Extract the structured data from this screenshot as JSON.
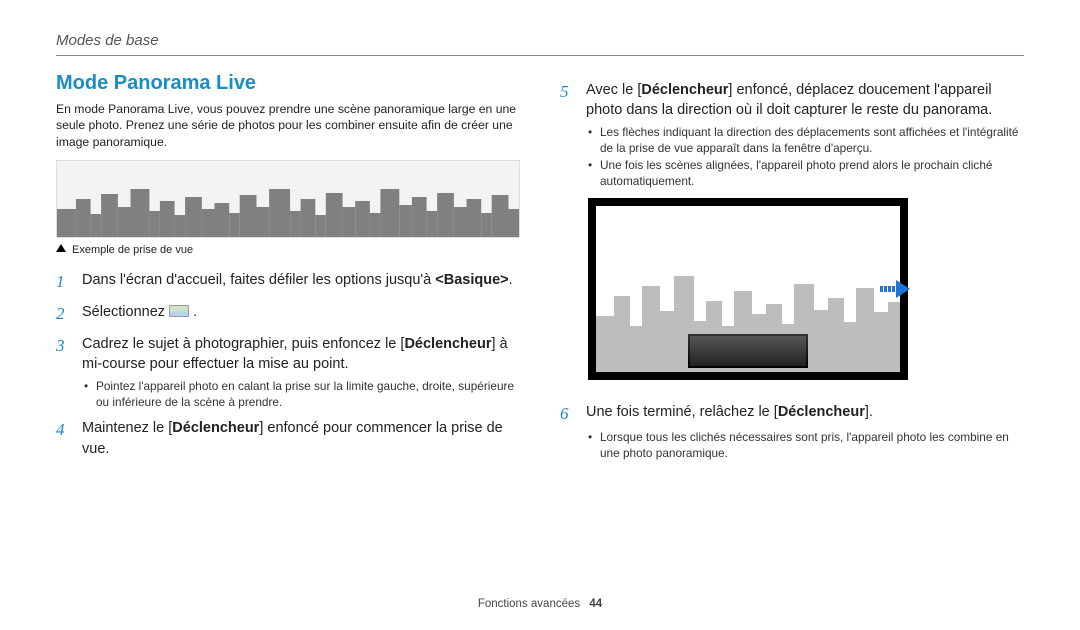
{
  "header": "Modes de base",
  "title": "Mode Panorama Live",
  "intro": "En mode Panorama Live, vous pouvez prendre une scène panoramique large en une seule photo. Prenez une série de photos pour les combiner ensuite afin de créer une image panoramique.",
  "caption": "Exemple de prise de vue",
  "left_steps": {
    "s1": {
      "num": "1",
      "pre": "Dans l'écran d'accueil, faites défiler les options jusqu'à ",
      "bold": "<Basique>",
      "post": "."
    },
    "s2": {
      "num": "2",
      "pre": "Sélectionnez ",
      "post": " ."
    },
    "s3": {
      "num": "3",
      "pre": "Cadrez le sujet à photographier, puis enfoncez le [",
      "bold": "Déclencheur",
      "post": "] à mi-course pour effectuer la mise au point.",
      "bullet1": "Pointez l'appareil photo en calant la prise sur la limite gauche, droite, supérieure ou inférieure de la scène à prendre."
    },
    "s4": {
      "num": "4",
      "pre": "Maintenez le [",
      "bold": "Déclencheur",
      "post": "] enfoncé pour commencer la prise de vue."
    }
  },
  "right_steps": {
    "s5": {
      "num": "5",
      "pre": "Avec le [",
      "bold": "Déclencheur",
      "post": "] enfoncé, déplacez doucement l'appareil photo dans la direction où il doit capturer le reste du panorama.",
      "bullet1": "Les flèches indiquant la direction des déplacements sont affichées et l'intégralité de la prise de vue apparaît dans la fenêtre d'aperçu.",
      "bullet2": "Une fois les scènes alignées, l'appareil photo prend alors le prochain cliché automatiquement."
    },
    "s6": {
      "num": "6",
      "pre": "Une fois terminé, relâchez le [",
      "bold": "Déclencheur",
      "post": "].",
      "bullet1": "Lorsque tous les clichés nécessaires sont pris, l'appareil photo les combine en une photo panoramique."
    }
  },
  "footer": {
    "section": "Fonctions avancées",
    "page": "44"
  }
}
